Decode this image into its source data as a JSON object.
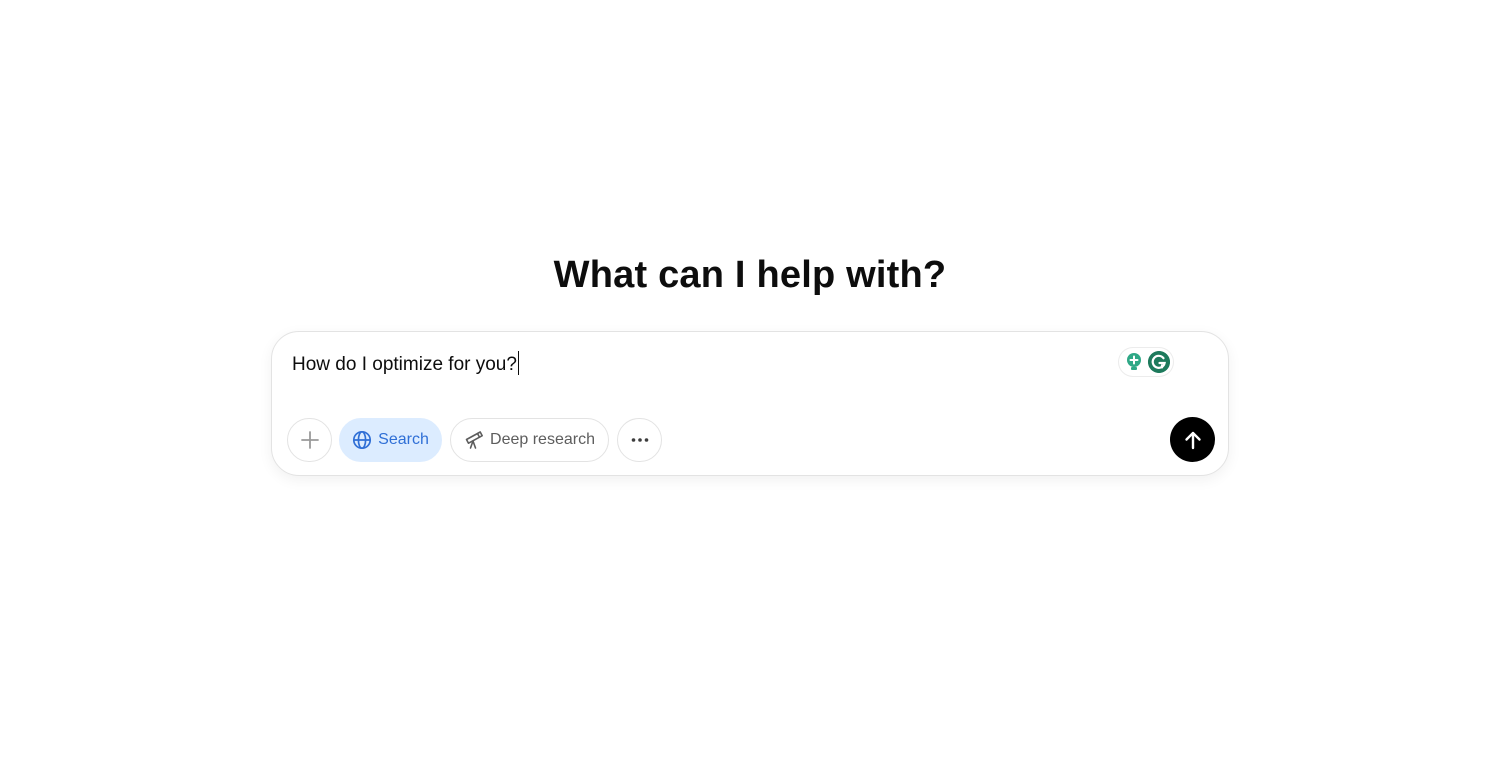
{
  "heading": "What can I help with?",
  "composer": {
    "input_value": "How do I optimize for you?"
  },
  "toolbar": {
    "search_label": "Search",
    "deep_research_label": "Deep research"
  },
  "icons": {
    "attach": "plus-icon",
    "search": "globe-icon",
    "deep_research": "telescope-icon",
    "more": "ellipsis-icon",
    "send": "arrow-up-icon",
    "extension_1": "lightbulb-icon",
    "extension_2": "grammarly-icon"
  },
  "colors": {
    "search_active_bg": "#dcecff",
    "search_active_text": "#2f6fd6",
    "send_bg": "#000000",
    "extension_green": "#1d7a5c"
  }
}
